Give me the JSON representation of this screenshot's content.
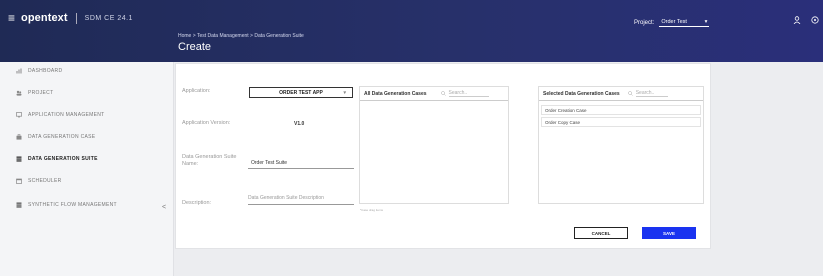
{
  "topbar": {
    "logo": "opentext",
    "product": "SDM  CE 24.1",
    "breadcrumb": "Home  >  Test Data Management  >  Data Generation Suite",
    "title": "Create",
    "project_label": "Project:",
    "project_value": "Order Test",
    "icons": [
      "menu-icon",
      "user-icon",
      "help-icon"
    ]
  },
  "sidebar": {
    "items": [
      {
        "label": "DASHBOARD",
        "icon": "dashboard-icon",
        "active": false
      },
      {
        "label": "PROJECT",
        "icon": "project-icon",
        "active": false
      },
      {
        "label": "APPLICATION MANAGEMENT",
        "icon": "monitor-icon",
        "active": false
      },
      {
        "label": "DATA GENERATION CASE",
        "icon": "case-icon",
        "active": false
      },
      {
        "label": "DATA GENERATION SUITE",
        "icon": "suite-icon",
        "active": true
      },
      {
        "label": "SCHEDULER",
        "icon": "calendar-icon",
        "active": false
      },
      {
        "label": "SYNTHETIC FLOW MANAGEMENT",
        "icon": "flow-icon",
        "active": false
      }
    ],
    "collapse": "<"
  },
  "form": {
    "application_label": "Application:",
    "application_value": "ORDER TEST APP",
    "version_label": "Application Version:",
    "version_value": "V1.0",
    "suite_name_label": "Data Generation Suite Name:",
    "suite_name_value": "Order Test Suite",
    "description_label": "Description:",
    "description_placeholder": "Data Generation Suite Description"
  },
  "all_cases": {
    "title": "All Data Generation Cases",
    "search_placeholder": "Search..",
    "items": [],
    "help": "*Case drag items"
  },
  "selected_cases": {
    "title": "Selected Data Generation Cases",
    "search_placeholder": "Search..",
    "items": [
      "Order Creation Case",
      "Order Copy Case"
    ]
  },
  "actions": {
    "cancel": "CANCEL",
    "save": "SAVE"
  },
  "colors": {
    "topbar": "#27306a",
    "primary_button": "#1a33f0"
  }
}
